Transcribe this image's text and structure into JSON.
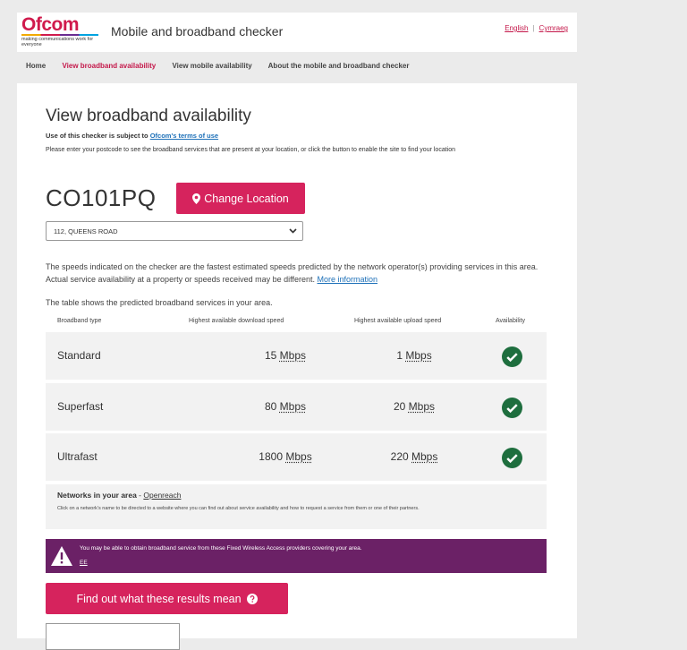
{
  "header": {
    "logo_text": "Ofcom",
    "logo_tagline": "making communications work for everyone",
    "app_title": "Mobile and broadband checker",
    "lang_english": "English",
    "lang_separator": "|",
    "lang_welsh": "Cymraeg"
  },
  "nav": {
    "items": [
      {
        "label": "Home"
      },
      {
        "label": "View broadband availability"
      },
      {
        "label": "View mobile availability"
      },
      {
        "label": "About the mobile and broadband checker"
      }
    ]
  },
  "main": {
    "title": "View broadband availability",
    "terms_prefix": "Use of this checker is subject to ",
    "terms_link": "Ofcom's terms of use",
    "intro": "Please enter your postcode to see the broadband services that are present at your location, or click the button to enable the site to find your location",
    "postcode": "CO101PQ",
    "change_location_label": "Change Location",
    "address_selected": "112, QUEENS ROAD",
    "speeds_note": "The speeds indicated on the checker are the fastest estimated speeds predicted by the network operator(s) providing services in this area. Actual service availability at a property or speeds received may be different. ",
    "more_info_link": "More information",
    "table_note": "The table shows the predicted broadband services in your area."
  },
  "table": {
    "headers": {
      "type": "Broadband type",
      "download": "Highest available download speed",
      "upload": "Highest available upload speed",
      "availability": "Availability"
    },
    "rows": [
      {
        "type": "Standard",
        "download": "15",
        "download_unit": "Mbps",
        "upload": "1",
        "upload_unit": "Mbps",
        "available": true
      },
      {
        "type": "Superfast",
        "download": "80",
        "download_unit": "Mbps",
        "upload": "20",
        "upload_unit": "Mbps",
        "available": true
      },
      {
        "type": "Ultrafast",
        "download": "1800",
        "download_unit": "Mbps",
        "upload": "220",
        "upload_unit": "Mbps",
        "available": true
      }
    ]
  },
  "networks": {
    "label": "Networks in your area",
    "separator": " - ",
    "network_link": "Openreach",
    "description": "Click on a network's name to be directed to a website where you can find out about service availability and how to request a service from them or one of their partners."
  },
  "fwa": {
    "message": "You may be able to obtain broadband service from these Fixed Wireless Access providers covering your area.",
    "provider_link": "EE"
  },
  "find_out_label": "Find out what these results mean",
  "colors": {
    "brand": "#d6235d",
    "purple_banner": "#6b2166",
    "check_green": "#1e6e3e",
    "link_blue": "#1d70b8"
  },
  "icons": {
    "location": "map-marker-icon",
    "dropdown": "chevron-down-icon",
    "available": "check-circle-icon",
    "warning": "warning-triangle-icon",
    "help": "question-circle-icon"
  }
}
